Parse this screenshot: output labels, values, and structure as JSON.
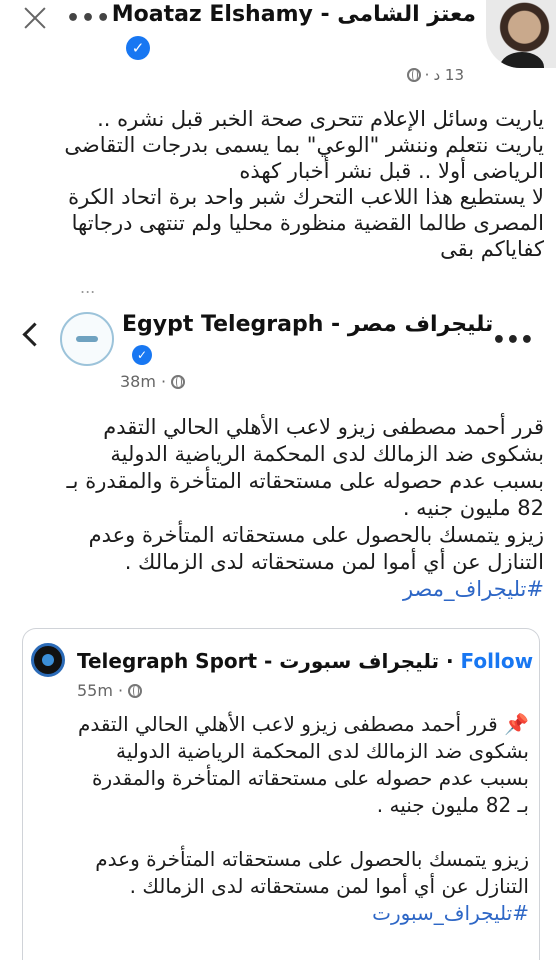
{
  "header": {
    "author_name": "Moataz Elshamy - معتز الشامى",
    "time": "13 د",
    "more_label": "•••",
    "verified_mark": "✓"
  },
  "post": {
    "lines": [
      "ياريت وسائل الإعلام تتحرى صحة الخبر قبل نشره ..",
      "ياريت نتعلم وننشر \"الوعي\" بما يسمى بدرجات التقاضى",
      "الرياضى أولا .. قبل نشر أخبار كهذه",
      "لا يستطيع هذا اللاعب التحرك شبر واحد برة اتحاد الكرة",
      "المصرى طالما القضية منظورة محليا ولم تنتهى درجاتها",
      "كفاياكم بقى"
    ],
    "see_more": "..."
  },
  "shared": {
    "page_name": "Egypt Telegraph - تليجراف مصر",
    "time": "38m",
    "more_label": "•••",
    "lines": [
      "قرر أحمد مصطفى زيزو لاعب الأهلي الحالي التقدم",
      "بشكوى ضد الزمالك لدى المحكمة الرياضية الدولية",
      "بسبب عدم حصوله على مستحقاته المتأخرة والمقدرة بـ",
      "82 مليون جنيه .",
      "زيزو يتمسك  بالحصول على مستحقاته المتأخرة وعدم",
      "التنازل عن أي أموا لمن مستحقاته لدى الزمالك ."
    ],
    "hashtag": "#تليجراف_مصر"
  },
  "quoted": {
    "page_name": "Telegraph Sport - تليجراف سبورت",
    "separator": " · ",
    "follow_label": "Follow",
    "time": "55m",
    "pin": "📌",
    "lines": [
      "قرر أحمد مصطفى زيزو لاعب الأهلي الحالي التقدم",
      "بشكوى ضد الزمالك لدى المحكمة الرياضية الدولية",
      "بسبب عدم حصوله على مستحقاته المتأخرة والمقدرة",
      "بـ 82 مليون جنيه .",
      "",
      "زيزو يتمسك  بالحصول على مستحقاته المتأخرة وعدم",
      "التنازل عن أي أموا لمن مستحقاته لدى الزمالك ."
    ],
    "hashtag": "#تليجراف_سبورت"
  },
  "colors": {
    "link": "#1877f2",
    "hashtag": "#2e67c6",
    "meta": "#666666"
  }
}
